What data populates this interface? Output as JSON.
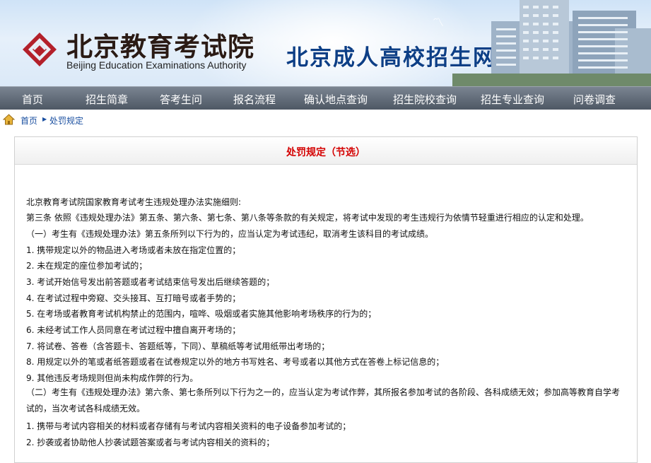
{
  "header": {
    "org_name_cn": "北京教育考试院",
    "org_name_en": "Beijing Education Examinations Authority",
    "site_title": "北京成人高校招生网上报名"
  },
  "nav": {
    "items": [
      "首页",
      "招生简章",
      "答考生问",
      "报名流程",
      "确认地点查询",
      "招生院校查询",
      "招生专业查询",
      "问卷调查"
    ]
  },
  "breadcrumb": {
    "home": "首页",
    "current": "处罚规定"
  },
  "article": {
    "title": "处罚规定（节选）",
    "lines": [
      "北京教育考试院国家教育考试考生违规处理办法实施细则:",
      "第三条 依照《违规处理办法》第五条、第六条、第七条、第八条等条款的有关规定，将考试中发现的考生违规行为依情节轻重进行相应的认定和处理。",
      "（一）考生有《违规处理办法》第五条所列以下行为的，应当认定为考试违纪，取消考生该科目的考试成绩。",
      "1. 携带规定以外的物品进入考场或者未放在指定位置的；",
      "2. 未在规定的座位参加考试的；",
      "3. 考试开始信号发出前答题或者考试结束信号发出后继续答题的；",
      "4. 在考试过程中旁窥、交头接耳、互打暗号或者手势的；",
      "5. 在考场或者教育考试机构禁止的范围内，喧哗、吸烟或者实施其他影响考场秩序的行为的；",
      "6. 未经考试工作人员同意在考试过程中擅自离开考场的；",
      "7. 将试卷、答卷（含答题卡、答题纸等，下同）、草稿纸等考试用纸带出考场的；",
      "8. 用规定以外的笔或者纸答题或者在试卷规定以外的地方书写姓名、考号或者以其他方式在答卷上标记信息的；",
      "9. 其他违反考场规则但尚未构成作弊的行为。",
      "（二）考生有《违规处理办法》第六条、第七条所列以下行为之一的，应当认定为考试作弊，其所报名参加考试的各阶段、各科成绩无效；参加高等教育自学考试的，当次考试各科成绩无效。",
      "1. 携带与考试内容相关的材料或者存储有与考试内容相关资料的电子设备参加考试的；",
      "2. 抄袭或者协助他人抄袭试题答案或者与考试内容相关的资料的；"
    ]
  },
  "colors": {
    "nav_bg": "#5f6975",
    "title_red": "#d40000",
    "link_blue": "#1a4fa0",
    "site_title_blue": "#0d3f86"
  }
}
